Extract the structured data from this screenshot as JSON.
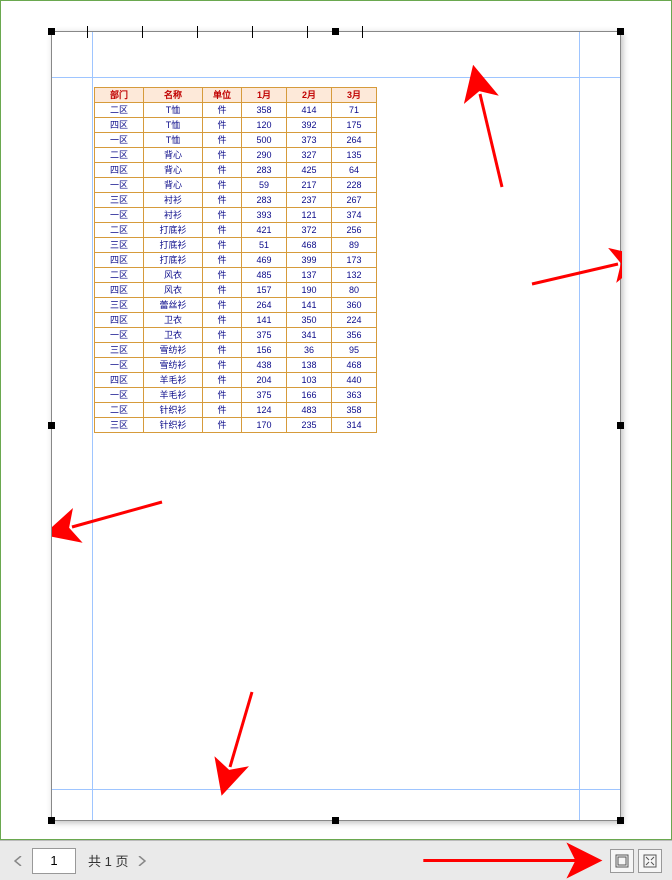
{
  "page_nav": {
    "current": "1",
    "total_label": "共 1 页"
  },
  "viewmodes": {
    "single": "single-page-icon",
    "fit": "fit-page-icon"
  },
  "table": {
    "headers": [
      "部门",
      "名称",
      "单位",
      "1月",
      "2月",
      "3月"
    ],
    "rows": [
      [
        "二区",
        "T恤",
        "件",
        "358",
        "414",
        "71"
      ],
      [
        "四区",
        "T恤",
        "件",
        "120",
        "392",
        "175"
      ],
      [
        "一区",
        "T恤",
        "件",
        "500",
        "373",
        "264"
      ],
      [
        "二区",
        "背心",
        "件",
        "290",
        "327",
        "135"
      ],
      [
        "四区",
        "背心",
        "件",
        "283",
        "425",
        "64"
      ],
      [
        "一区",
        "背心",
        "件",
        "59",
        "217",
        "228"
      ],
      [
        "三区",
        "衬衫",
        "件",
        "283",
        "237",
        "267"
      ],
      [
        "一区",
        "衬衫",
        "件",
        "393",
        "121",
        "374"
      ],
      [
        "二区",
        "打底衫",
        "件",
        "421",
        "372",
        "256"
      ],
      [
        "三区",
        "打底衫",
        "件",
        "51",
        "468",
        "89"
      ],
      [
        "四区",
        "打底衫",
        "件",
        "469",
        "399",
        "173"
      ],
      [
        "二区",
        "风衣",
        "件",
        "485",
        "137",
        "132"
      ],
      [
        "四区",
        "风衣",
        "件",
        "157",
        "190",
        "80"
      ],
      [
        "三区",
        "蕾丝衫",
        "件",
        "264",
        "141",
        "360"
      ],
      [
        "四区",
        "卫衣",
        "件",
        "141",
        "350",
        "224"
      ],
      [
        "一区",
        "卫衣",
        "件",
        "375",
        "341",
        "356"
      ],
      [
        "三区",
        "雪纺衫",
        "件",
        "156",
        "36",
        "95"
      ],
      [
        "一区",
        "雪纺衫",
        "件",
        "438",
        "138",
        "468"
      ],
      [
        "四区",
        "羊毛衫",
        "件",
        "204",
        "103",
        "440"
      ],
      [
        "一区",
        "羊毛衫",
        "件",
        "375",
        "166",
        "363"
      ],
      [
        "二区",
        "针织衫",
        "件",
        "124",
        "483",
        "358"
      ],
      [
        "三区",
        "针织衫",
        "件",
        "170",
        "235",
        "314"
      ]
    ]
  },
  "chart_data": {
    "type": "table",
    "title": "",
    "columns": [
      "部门",
      "名称",
      "单位",
      "1月",
      "2月",
      "3月"
    ],
    "records": [
      {
        "部门": "二区",
        "名称": "T恤",
        "单位": "件",
        "1月": 358,
        "2月": 414,
        "3月": 71
      },
      {
        "部门": "四区",
        "名称": "T恤",
        "单位": "件",
        "1月": 120,
        "2月": 392,
        "3月": 175
      },
      {
        "部门": "一区",
        "名称": "T恤",
        "单位": "件",
        "1月": 500,
        "2月": 373,
        "3月": 264
      },
      {
        "部门": "二区",
        "名称": "背心",
        "单位": "件",
        "1月": 290,
        "2月": 327,
        "3月": 135
      },
      {
        "部门": "四区",
        "名称": "背心",
        "单位": "件",
        "1月": 283,
        "2月": 425,
        "3月": 64
      },
      {
        "部门": "一区",
        "名称": "背心",
        "单位": "件",
        "1月": 59,
        "2月": 217,
        "3月": 228
      },
      {
        "部门": "三区",
        "名称": "衬衫",
        "单位": "件",
        "1月": 283,
        "2月": 237,
        "3月": 267
      },
      {
        "部门": "一区",
        "名称": "衬衫",
        "单位": "件",
        "1月": 393,
        "2月": 121,
        "3月": 374
      },
      {
        "部门": "二区",
        "名称": "打底衫",
        "单位": "件",
        "1月": 421,
        "2月": 372,
        "3月": 256
      },
      {
        "部门": "三区",
        "名称": "打底衫",
        "单位": "件",
        "1月": 51,
        "2月": 468,
        "3月": 89
      },
      {
        "部门": "四区",
        "名称": "打底衫",
        "单位": "件",
        "1月": 469,
        "2月": 399,
        "3月": 173
      },
      {
        "部门": "二区",
        "名称": "风衣",
        "单位": "件",
        "1月": 485,
        "2月": 137,
        "3月": 132
      },
      {
        "部门": "四区",
        "名称": "风衣",
        "单位": "件",
        "1月": 157,
        "2月": 190,
        "3月": 80
      },
      {
        "部门": "三区",
        "名称": "蕾丝衫",
        "单位": "件",
        "1月": 264,
        "2月": 141,
        "3月": 360
      },
      {
        "部门": "四区",
        "名称": "卫衣",
        "单位": "件",
        "1月": 141,
        "2月": 350,
        "3月": 224
      },
      {
        "部门": "一区",
        "名称": "卫衣",
        "单位": "件",
        "1月": 375,
        "2月": 341,
        "3月": 356
      },
      {
        "部门": "三区",
        "名称": "雪纺衫",
        "单位": "件",
        "1月": 156,
        "2月": 36,
        "3月": 95
      },
      {
        "部门": "一区",
        "名称": "雪纺衫",
        "单位": "件",
        "1月": 438,
        "2月": 138,
        "3月": 468
      },
      {
        "部门": "四区",
        "名称": "羊毛衫",
        "单位": "件",
        "1月": 204,
        "2月": 103,
        "3月": 440
      },
      {
        "部门": "一区",
        "名称": "羊毛衫",
        "单位": "件",
        "1月": 375,
        "2月": 166,
        "3月": 363
      },
      {
        "部门": "二区",
        "名称": "针织衫",
        "单位": "件",
        "1月": 124,
        "2月": 483,
        "3月": 358
      },
      {
        "部门": "三区",
        "名称": "针织衫",
        "单位": "件",
        "1月": 170,
        "2月": 235,
        "3月": 314
      }
    ]
  }
}
